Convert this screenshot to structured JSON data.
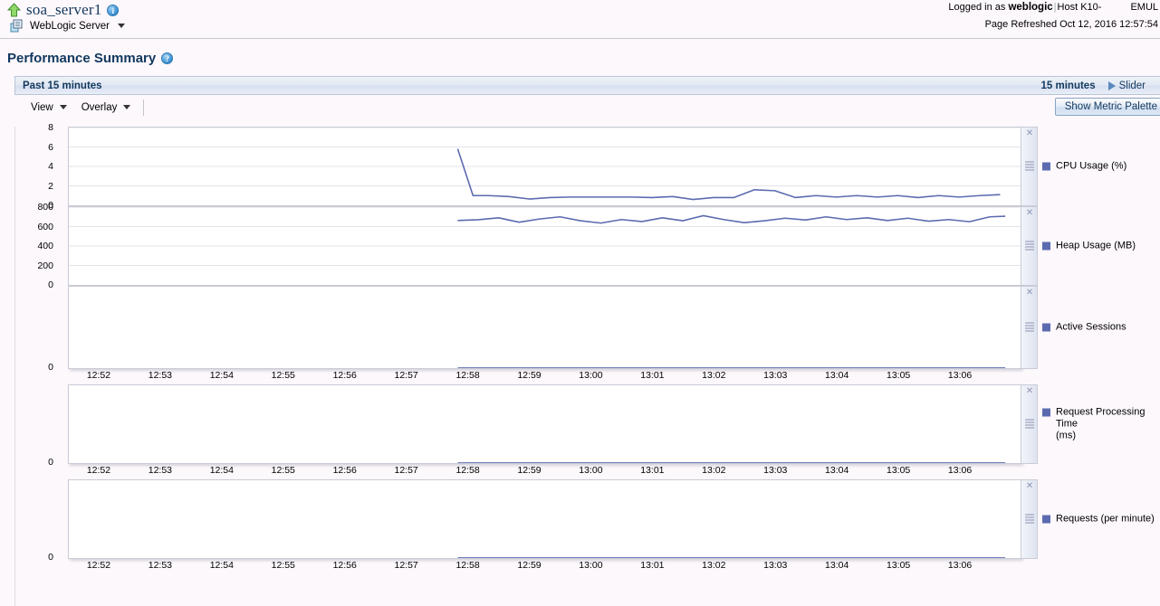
{
  "header": {
    "server_name": "soa_server1",
    "up_arrow_icon": "up-arrow-icon",
    "info_icon": "info-icon",
    "server_type_icon": "weblogic-server-icon",
    "server_type": "WebLogic Server",
    "logged_in_prefix": "Logged in as",
    "logged_in_user": "weblogic",
    "host_label": "Host K10-",
    "host_suffix": "EMUL",
    "page_refreshed": "Page Refreshed Oct 12, 2016 12:57:54"
  },
  "page": {
    "title": "Performance Summary",
    "help_icon": "help-icon"
  },
  "range": {
    "label": "Past 15 minutes",
    "minutes": "15 minutes",
    "slider_label": "Slider",
    "slider_icon": "play-triangle-icon"
  },
  "toolbar": {
    "view_label": "View",
    "overlay_label": "Overlay",
    "show_palette_label": "Show Metric Palette"
  },
  "chart_data": [
    {
      "type": "line",
      "title": "CPU Usage (%)",
      "legend": "CPU Usage (%)",
      "color": "#5c6bb0",
      "ylabel": "",
      "xlabel": "",
      "ylim": [
        0,
        8
      ],
      "yticks": [
        8,
        6,
        4,
        2,
        0
      ],
      "grid": true,
      "x": [
        "12:52",
        "12:53",
        "12:54",
        "12:55",
        "12:56",
        "12:57",
        "12:58",
        "12:59",
        "13:00",
        "13:01",
        "13:02",
        "13:03",
        "13:04",
        "13:05",
        "13:06"
      ],
      "xlim": [
        "12:51:30",
        "13:06:45"
      ],
      "data_start_time": "12:57:50",
      "points": [
        {
          "t": "12:57:50",
          "v": 5.8
        },
        {
          "t": "12:58:05",
          "v": 1.0
        },
        {
          "t": "12:58:20",
          "v": 1.0
        },
        {
          "t": "12:58:40",
          "v": 0.9
        },
        {
          "t": "12:59:00",
          "v": 0.65
        },
        {
          "t": "12:59:20",
          "v": 0.8
        },
        {
          "t": "12:59:40",
          "v": 0.85
        },
        {
          "t": "13:00:00",
          "v": 0.85
        },
        {
          "t": "13:00:20",
          "v": 0.85
        },
        {
          "t": "13:00:40",
          "v": 0.85
        },
        {
          "t": "13:01:00",
          "v": 0.8
        },
        {
          "t": "13:01:20",
          "v": 0.9
        },
        {
          "t": "13:01:40",
          "v": 0.6
        },
        {
          "t": "13:02:00",
          "v": 0.8
        },
        {
          "t": "13:02:20",
          "v": 0.8
        },
        {
          "t": "13:02:40",
          "v": 1.6
        },
        {
          "t": "13:03:00",
          "v": 1.5
        },
        {
          "t": "13:03:20",
          "v": 0.8
        },
        {
          "t": "13:03:40",
          "v": 1.0
        },
        {
          "t": "13:04:00",
          "v": 0.85
        },
        {
          "t": "13:04:20",
          "v": 1.0
        },
        {
          "t": "13:04:40",
          "v": 0.85
        },
        {
          "t": "13:05:00",
          "v": 1.0
        },
        {
          "t": "13:05:20",
          "v": 0.8
        },
        {
          "t": "13:05:40",
          "v": 1.0
        },
        {
          "t": "13:06:00",
          "v": 0.85
        },
        {
          "t": "13:06:20",
          "v": 1.0
        },
        {
          "t": "13:06:40",
          "v": 1.1
        }
      ]
    },
    {
      "type": "line",
      "title": "Heap Usage (MB)",
      "legend": "Heap Usage (MB)",
      "color": "#5c6bb0",
      "ylabel": "",
      "xlabel": "",
      "ylim": [
        0,
        800
      ],
      "yticks": [
        800,
        600,
        400,
        200,
        0
      ],
      "grid": true,
      "x": [
        "12:52",
        "12:53",
        "12:54",
        "12:55",
        "12:56",
        "12:57",
        "12:58",
        "12:59",
        "13:00",
        "13:01",
        "13:02",
        "13:03",
        "13:04",
        "13:05",
        "13:06"
      ],
      "data_start_time": "12:57:50",
      "points": [
        {
          "t": "12:57:50",
          "v": 662
        },
        {
          "t": "12:58:10",
          "v": 670
        },
        {
          "t": "12:58:30",
          "v": 690
        },
        {
          "t": "12:58:50",
          "v": 645
        },
        {
          "t": "12:59:10",
          "v": 678
        },
        {
          "t": "12:59:30",
          "v": 700
        },
        {
          "t": "12:59:50",
          "v": 660
        },
        {
          "t": "13:00:10",
          "v": 636
        },
        {
          "t": "13:00:30",
          "v": 672
        },
        {
          "t": "13:00:50",
          "v": 652
        },
        {
          "t": "13:01:10",
          "v": 690
        },
        {
          "t": "13:01:30",
          "v": 660
        },
        {
          "t": "13:01:50",
          "v": 712
        },
        {
          "t": "13:02:10",
          "v": 672
        },
        {
          "t": "13:02:30",
          "v": 640
        },
        {
          "t": "13:02:50",
          "v": 660
        },
        {
          "t": "13:03:10",
          "v": 686
        },
        {
          "t": "13:03:30",
          "v": 668
        },
        {
          "t": "13:03:50",
          "v": 700
        },
        {
          "t": "13:04:10",
          "v": 672
        },
        {
          "t": "13:04:30",
          "v": 690
        },
        {
          "t": "13:04:50",
          "v": 662
        },
        {
          "t": "13:05:10",
          "v": 686
        },
        {
          "t": "13:05:30",
          "v": 655
        },
        {
          "t": "13:05:50",
          "v": 672
        },
        {
          "t": "13:06:10",
          "v": 650
        },
        {
          "t": "13:06:30",
          "v": 700
        },
        {
          "t": "13:06:45",
          "v": 706
        }
      ]
    },
    {
      "type": "line",
      "title": "Active Sessions",
      "legend": "Active Sessions",
      "color": "#5c6bb0",
      "ylabel": "",
      "xlabel": "",
      "ylim": [
        0,
        1
      ],
      "yticks": [
        0
      ],
      "grid": false,
      "x": [
        "12:52",
        "12:53",
        "12:54",
        "12:55",
        "12:56",
        "12:57",
        "12:58",
        "12:59",
        "13:00",
        "13:01",
        "13:02",
        "13:03",
        "13:04",
        "13:05",
        "13:06"
      ],
      "data_start_time": "12:57:50",
      "points": [
        {
          "t": "12:57:50",
          "v": 0
        },
        {
          "t": "13:06:45",
          "v": 0
        }
      ]
    },
    {
      "type": "line",
      "title": "Request Processing Time (ms)",
      "legend": "Request Processing Time\n(ms)",
      "color": "#5c6bb0",
      "ylabel": "",
      "xlabel": "",
      "ylim": [
        0,
        1
      ],
      "yticks": [
        0
      ],
      "grid": false,
      "x": [
        "12:52",
        "12:53",
        "12:54",
        "12:55",
        "12:56",
        "12:57",
        "12:58",
        "12:59",
        "13:00",
        "13:01",
        "13:02",
        "13:03",
        "13:04",
        "13:05",
        "13:06"
      ],
      "data_start_time": "12:57:50",
      "points": [
        {
          "t": "12:57:50",
          "v": 0
        },
        {
          "t": "13:06:45",
          "v": 0
        }
      ]
    },
    {
      "type": "line",
      "title": "Requests (per minute)",
      "legend": "Requests (per minute)",
      "color": "#5c6bb0",
      "ylabel": "",
      "xlabel": "",
      "ylim": [
        0,
        1
      ],
      "yticks": [
        0
      ],
      "grid": false,
      "x": [
        "12:52",
        "12:53",
        "12:54",
        "12:55",
        "12:56",
        "12:57",
        "12:58",
        "12:59",
        "13:00",
        "13:01",
        "13:02",
        "13:03",
        "13:04",
        "13:05",
        "13:06"
      ],
      "data_start_time": "12:57:50",
      "points": [
        {
          "t": "12:57:50",
          "v": 0
        },
        {
          "t": "13:06:45",
          "v": 0
        }
      ]
    }
  ],
  "chart_controls": {
    "close_icon": "close-icon",
    "resize_grip_icon": "resize-grip-icon"
  }
}
